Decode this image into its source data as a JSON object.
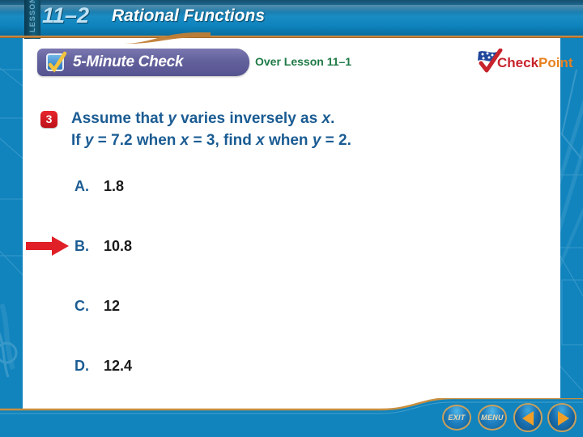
{
  "header": {
    "lesson_label": "LESSON",
    "lesson_number": "11–2",
    "lesson_title": "Rational Functions"
  },
  "banner": {
    "check_icon": "checkbox-check-icon",
    "label": "5-Minute Check",
    "over_lesson": "Over Lesson 11–1"
  },
  "logo": {
    "flag_icon": "flag-check-icon",
    "check_word": "Check",
    "point_word": "Point"
  },
  "question": {
    "number": "3",
    "line1_a": "Assume that ",
    "line1_y": "y",
    "line1_b": " varies inversely as ",
    "line1_x": "x",
    "line1_c": ".",
    "line2_a": "If ",
    "line2_y": "y",
    "line2_b": " = 7.2 when ",
    "line2_x": "x",
    "line2_c": " = 3, find ",
    "line2_x2": "x",
    "line2_d": " when ",
    "line2_y2": "y",
    "line2_e": " = 2."
  },
  "choices": [
    {
      "letter": "A.",
      "value": "1.8",
      "marked": false
    },
    {
      "letter": "B.",
      "value": "10.8",
      "marked": true
    },
    {
      "letter": "C.",
      "value": "12",
      "marked": false
    },
    {
      "letter": "D.",
      "value": "12.4",
      "marked": false
    }
  ],
  "answer_marker": "right-arrow-icon",
  "bottom_nav": {
    "exit_label": "EXIT",
    "menu_label": "MENU",
    "back_icon": "triangle-left-icon",
    "forward_icon": "triangle-right-icon"
  },
  "colors": {
    "rail_blue": "#1184be",
    "header_blue": "#1a8cc4",
    "accent_orange": "#c07d35",
    "question_blue": "#1b5c93",
    "badge_red": "#d1181f",
    "banner_purple": "#63619c",
    "green": "#1f7a46"
  }
}
